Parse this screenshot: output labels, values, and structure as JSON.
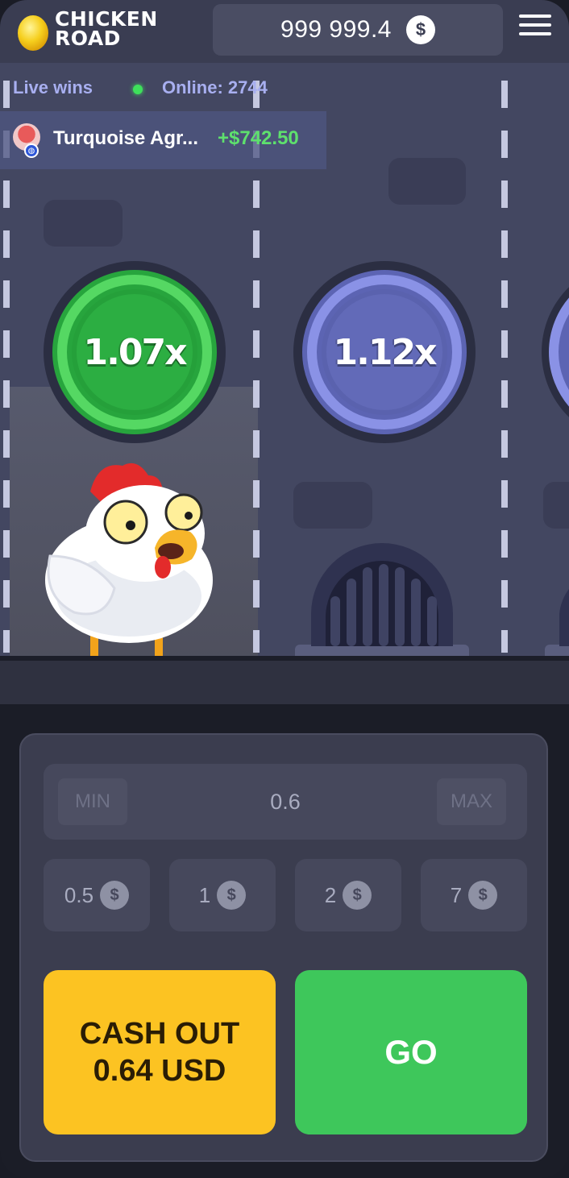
{
  "app": {
    "logo_line1": "CHICKEN",
    "logo_line2": "ROAD"
  },
  "header": {
    "balance": "999 999.4",
    "currency_symbol": "$",
    "menu_icon": "hamburger-menu-icon"
  },
  "live": {
    "label": "Live wins",
    "online_label": "Online: 2744"
  },
  "latest_win": {
    "name": "Turquoise Agr...",
    "amount": "+$742.50"
  },
  "lanes": [
    {
      "multiplier": "1.07x",
      "state": "passed"
    },
    {
      "multiplier": "1.12x",
      "state": "next"
    }
  ],
  "bet": {
    "min_label": "MIN",
    "max_label": "MAX",
    "value": "0.6"
  },
  "chips": [
    {
      "value": "0.5",
      "symbol": "$"
    },
    {
      "value": "1",
      "symbol": "$"
    },
    {
      "value": "2",
      "symbol": "$"
    },
    {
      "value": "7",
      "symbol": "$"
    }
  ],
  "actions": {
    "cashout_line1": "CASH OUT",
    "cashout_line2": "0.64 USD",
    "go_label": "GO"
  },
  "colors": {
    "accent_green": "#3ec75b",
    "cashout_yellow": "#fcc322",
    "win_green": "#5ee06d",
    "live_text": "#a8aff0"
  }
}
